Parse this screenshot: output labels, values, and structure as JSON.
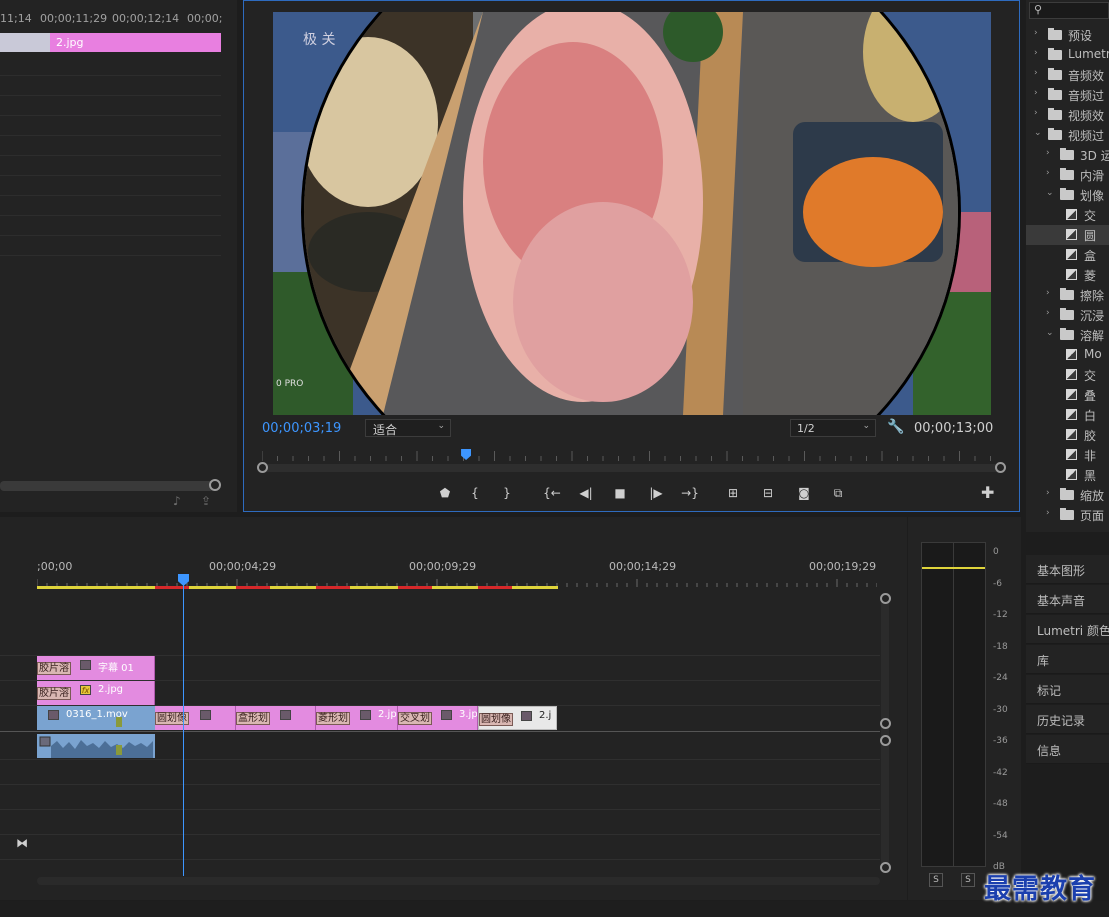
{
  "source_monitor": {
    "ruler": [
      "11;14",
      "00;00;11;29",
      "00;00;12;14",
      "00;00;"
    ],
    "clip_name": "2.jpg"
  },
  "program_monitor": {
    "video_overlay_text": "极 关",
    "camera_text": "0 PRO",
    "timecode": "00;00;03;19",
    "fit": "适合",
    "resolution": "1/2",
    "duration": "00;00;13;00",
    "playhead_position": 0.275,
    "transport_icons": [
      "marker-icon",
      "mark-in-icon",
      "mark-out-icon",
      "go-to-in-icon",
      "step-back-icon",
      "stop-icon",
      "play-icon",
      "go-to-out-icon",
      "lift-icon",
      "extract-icon",
      "export-frame-icon",
      "comparison-view-icon"
    ]
  },
  "effects_panel": {
    "items": [
      {
        "label": "预设",
        "kind": "folder-star",
        "depth": 0,
        "expanded": false
      },
      {
        "label": "Lumetri",
        "kind": "folder-star",
        "depth": 0,
        "expanded": false
      },
      {
        "label": "音频效",
        "kind": "folder",
        "depth": 0,
        "expanded": false
      },
      {
        "label": "音频过",
        "kind": "folder",
        "depth": 0,
        "expanded": false
      },
      {
        "label": "视频效",
        "kind": "folder",
        "depth": 0,
        "expanded": false
      },
      {
        "label": "视频过",
        "kind": "folder",
        "depth": 0,
        "expanded": true
      },
      {
        "label": "3D 运",
        "kind": "folder",
        "depth": 1,
        "expanded": false
      },
      {
        "label": "内滑",
        "kind": "folder",
        "depth": 1,
        "expanded": false
      },
      {
        "label": "划像",
        "kind": "folder",
        "depth": 1,
        "expanded": true
      },
      {
        "label": "交",
        "kind": "transition",
        "depth": 2
      },
      {
        "label": "圆",
        "kind": "transition",
        "depth": 2,
        "selected": true
      },
      {
        "label": "盒",
        "kind": "transition",
        "depth": 2
      },
      {
        "label": "菱",
        "kind": "transition",
        "depth": 2
      },
      {
        "label": "擦除",
        "kind": "folder",
        "depth": 1,
        "expanded": false
      },
      {
        "label": "沉浸",
        "kind": "folder",
        "depth": 1,
        "expanded": false
      },
      {
        "label": "溶解",
        "kind": "folder",
        "depth": 1,
        "expanded": true
      },
      {
        "label": "Mo",
        "kind": "transition",
        "depth": 2
      },
      {
        "label": "交",
        "kind": "transition",
        "depth": 2
      },
      {
        "label": "叠",
        "kind": "transition",
        "depth": 2
      },
      {
        "label": "白",
        "kind": "transition",
        "depth": 2
      },
      {
        "label": "胶",
        "kind": "transition",
        "depth": 2
      },
      {
        "label": "非",
        "kind": "transition",
        "depth": 2
      },
      {
        "label": "黑",
        "kind": "transition",
        "depth": 2
      },
      {
        "label": "缩放",
        "kind": "folder",
        "depth": 1,
        "expanded": false
      },
      {
        "label": "页面",
        "kind": "folder",
        "depth": 1,
        "expanded": false
      }
    ]
  },
  "right_tabs": [
    "基本图形",
    "基本声音",
    "Lumetri 颜色",
    "库",
    "标记",
    "历史记录",
    "信息"
  ],
  "timeline": {
    "timecodes": [
      ";00;00",
      "00;00;04;29",
      "00;00;09;29",
      "00;00;14;29",
      "00;00;19;29"
    ],
    "v3": [
      {
        "label": "胶片溶",
        "name": "字幕 01"
      }
    ],
    "v2": [
      {
        "label": "胶片溶",
        "name": "2.jpg"
      }
    ],
    "v1": [
      {
        "name": "0316_1.mov",
        "type": "video"
      },
      {
        "label": "圆划像",
        "name": ""
      },
      {
        "label": "盒形划",
        "name": ""
      },
      {
        "label": "菱形划",
        "name": "2.jp"
      },
      {
        "label": "交叉划",
        "name": "3.jp"
      },
      {
        "label": "圆划像",
        "name": "2.j"
      }
    ]
  },
  "audio_meter": {
    "scale": [
      "0",
      "-6",
      "-12",
      "-18",
      "-24",
      "-30",
      "-36",
      "-42",
      "-48",
      "-54",
      "dB"
    ],
    "solo_labels": [
      "S",
      "S"
    ]
  },
  "watermark": "最需教育"
}
